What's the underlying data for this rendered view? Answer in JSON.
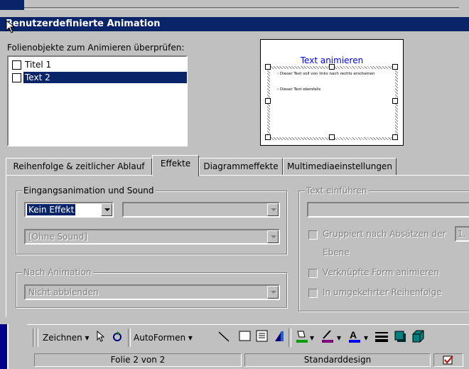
{
  "dialog": {
    "title": "Benutzerdefinierte Animation"
  },
  "objects": {
    "label": "Folienobjekte zum Animieren überprüfen:",
    "items": [
      {
        "label": "Titel 1",
        "checked": false,
        "selected": false
      },
      {
        "label": "Text 2",
        "checked": false,
        "selected": true
      }
    ]
  },
  "preview": {
    "title": "Text animieren",
    "bullet1": "Dieser Text soll von links nach rechts erscheinen",
    "bullet2": "Dieser Text ebenfalls"
  },
  "tabs": [
    {
      "label": "Reihenfolge & zeitlicher Ablauf",
      "active": false
    },
    {
      "label": "Effekte",
      "active": true
    },
    {
      "label": "Diagrammeffekte",
      "active": false
    },
    {
      "label": "Multimediaeinstellungen",
      "active": false
    }
  ],
  "effects": {
    "entry_group": "Eingangsanimation und Sound",
    "effect_value": "Kein Effekt",
    "direction_value": "",
    "sound_value": "[Ohne Sound]",
    "after_group": "Nach Animation",
    "after_value": "Nicht abblenden",
    "text_group": "Text einführen",
    "text_value": "",
    "group_paragraphs": "Gruppiert nach Absätzen der",
    "level_value": "1.",
    "level_label": "Ebene",
    "animate_shape": "Verknüpfte Form animieren",
    "reverse_order": "In umgekehrter Reihenfolge"
  },
  "toolbar": {
    "draw": "Zeichnen",
    "autoshapes": "AutoFormen"
  },
  "status": {
    "slide": "Folie 2 von 2",
    "design": "Standarddesign"
  },
  "colors": {
    "titlebar": "#0a246a",
    "selection": "#0a246a",
    "face": "#c0c0c0"
  }
}
